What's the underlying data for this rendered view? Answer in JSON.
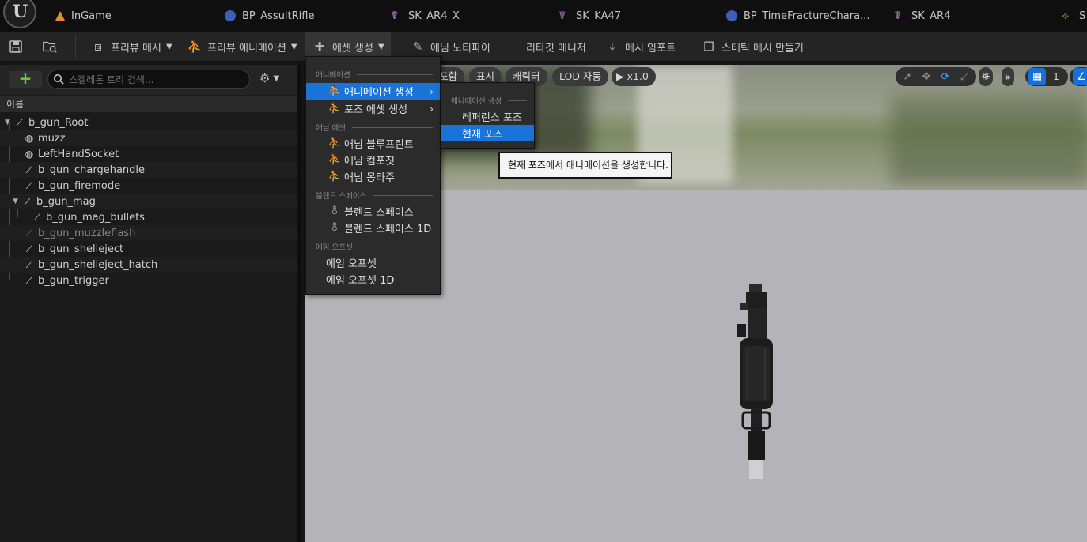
{
  "tabs": [
    {
      "label": "InGame",
      "icon": "level-icon"
    },
    {
      "label": "BP_AssultRifle",
      "icon": "blueprint-icon"
    },
    {
      "label": "SK_AR4_X",
      "icon": "skeleton-icon"
    },
    {
      "label": "SK_KA47",
      "icon": "skeleton-icon"
    },
    {
      "label": "BP_TimeFractureChara...",
      "icon": "blueprint-icon"
    },
    {
      "label": "SK_AR4",
      "icon": "skeleton-icon"
    },
    {
      "label": "S",
      "icon": "static-mesh-icon"
    }
  ],
  "toolbar": {
    "preview_mesh": "프리뷰 메시",
    "preview_anim": "프리뷰 애니메이션",
    "create_asset": "에셋 생성",
    "anim_notify": "애님 노티파이",
    "retarget_manager": "리타깃 매니저",
    "mesh_import": "메시 임포트",
    "make_static_mesh": "스태틱 메시 만들기"
  },
  "skeleton_tree": {
    "search_placeholder": "스켈레톤 트리 검색...",
    "column_name": "이름",
    "bones": [
      {
        "label": "b_gun_Root",
        "type": "bone"
      },
      {
        "label": "muzz",
        "type": "socket"
      },
      {
        "label": "LeftHandSocket",
        "type": "socket"
      },
      {
        "label": "b_gun_chargehandle",
        "type": "bone"
      },
      {
        "label": "b_gun_firemode",
        "type": "bone"
      },
      {
        "label": "b_gun_mag",
        "type": "bone"
      },
      {
        "label": "b_gun_mag_bullets",
        "type": "bone"
      },
      {
        "label": "b_gun_muzzleflash",
        "type": "bone"
      },
      {
        "label": "b_gun_shelleject",
        "type": "bone"
      },
      {
        "label": "b_gun_shelleject_hatch",
        "type": "bone"
      },
      {
        "label": "b_gun_trigger",
        "type": "bone"
      }
    ]
  },
  "viewport": {
    "pill_include": "포함",
    "pill_show": "표시",
    "pill_character": "캐릭터",
    "pill_lod": "LOD 자동",
    "pill_speed": "x1.0",
    "grid_value": "1"
  },
  "menu": {
    "section_animation": "애니메이션",
    "create_animation": "애니메이션 생성",
    "create_pose_asset": "포즈 에셋 생성",
    "section_anim_asset": "애님 에셋",
    "anim_blueprint": "애님 블루프린트",
    "anim_composite": "애님 컴포짓",
    "anim_montage": "애님 몽타주",
    "section_blendspace": "블렌드 스페이스",
    "blendspace": "블렌드 스페이스",
    "blendspace_1d": "블렌드 스페이스 1D",
    "section_aim_offset": "에임 오프셋",
    "aim_offset": "에임 오프셋",
    "aim_offset_1d": "에임 오프셋 1D"
  },
  "submenu": {
    "section": "애니메이션 생성",
    "reference_pose": "레퍼런스 포즈",
    "current_pose": "현재 포즈"
  },
  "tooltip": "현재 포즈에서 애니메이션을 생성합니다.",
  "colors": {
    "accent": "#1a74d8",
    "add_green": "#6fcf3a"
  }
}
